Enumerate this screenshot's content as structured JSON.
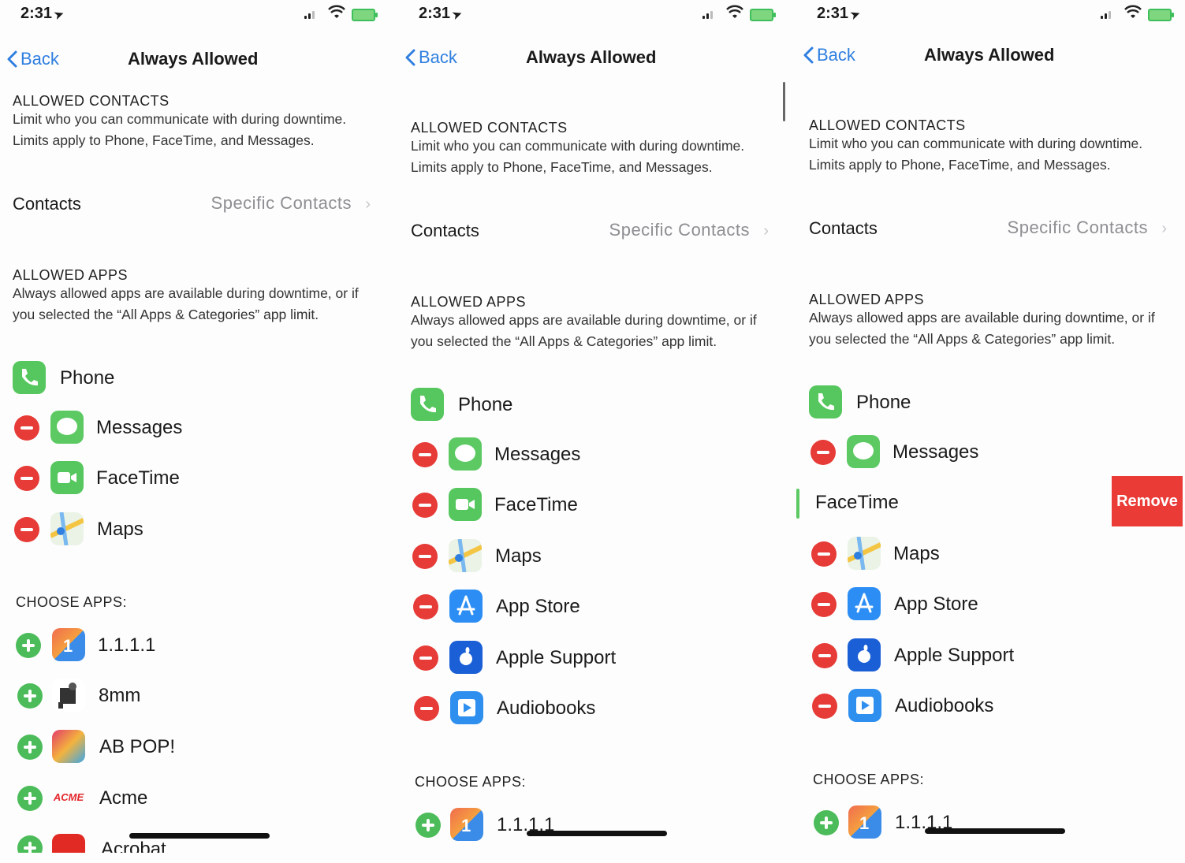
{
  "status": {
    "time": "2:31"
  },
  "nav": {
    "back_label": "Back",
    "title": "Always Allowed"
  },
  "contacts_section": {
    "header": "ALLOWED CONTACTS",
    "description": "Limit who you can communicate with during downtime. Limits apply to Phone, FaceTime, and Messages.",
    "row_label": "Contacts",
    "row_value": "Specific Contacts"
  },
  "apps_section": {
    "header": "ALLOWED APPS",
    "description": "Always allowed apps are available during downtime, or if you selected the “All Apps & Categories” app limit."
  },
  "choose_header": "CHOOSE APPS:",
  "allowed_apps": {
    "phone": "Phone",
    "messages": "Messages",
    "facetime": "FaceTime",
    "maps": "Maps",
    "app_store": "App Store",
    "apple_support": "Apple Support",
    "audiobooks": "Audiobooks"
  },
  "choose_apps": {
    "a1111": "1.1.1.1",
    "a8mm": "8mm",
    "abpop": "AB POP!",
    "acme": "Acme",
    "acrobat": "Acrobat"
  },
  "acme_logo_text": "ACME",
  "remove_label": "Remove",
  "colors": {
    "accent": "#2f7fe0",
    "destructive": "#ea3b37",
    "add": "#4cbc5a",
    "secondary_text": "#8e8e93"
  }
}
